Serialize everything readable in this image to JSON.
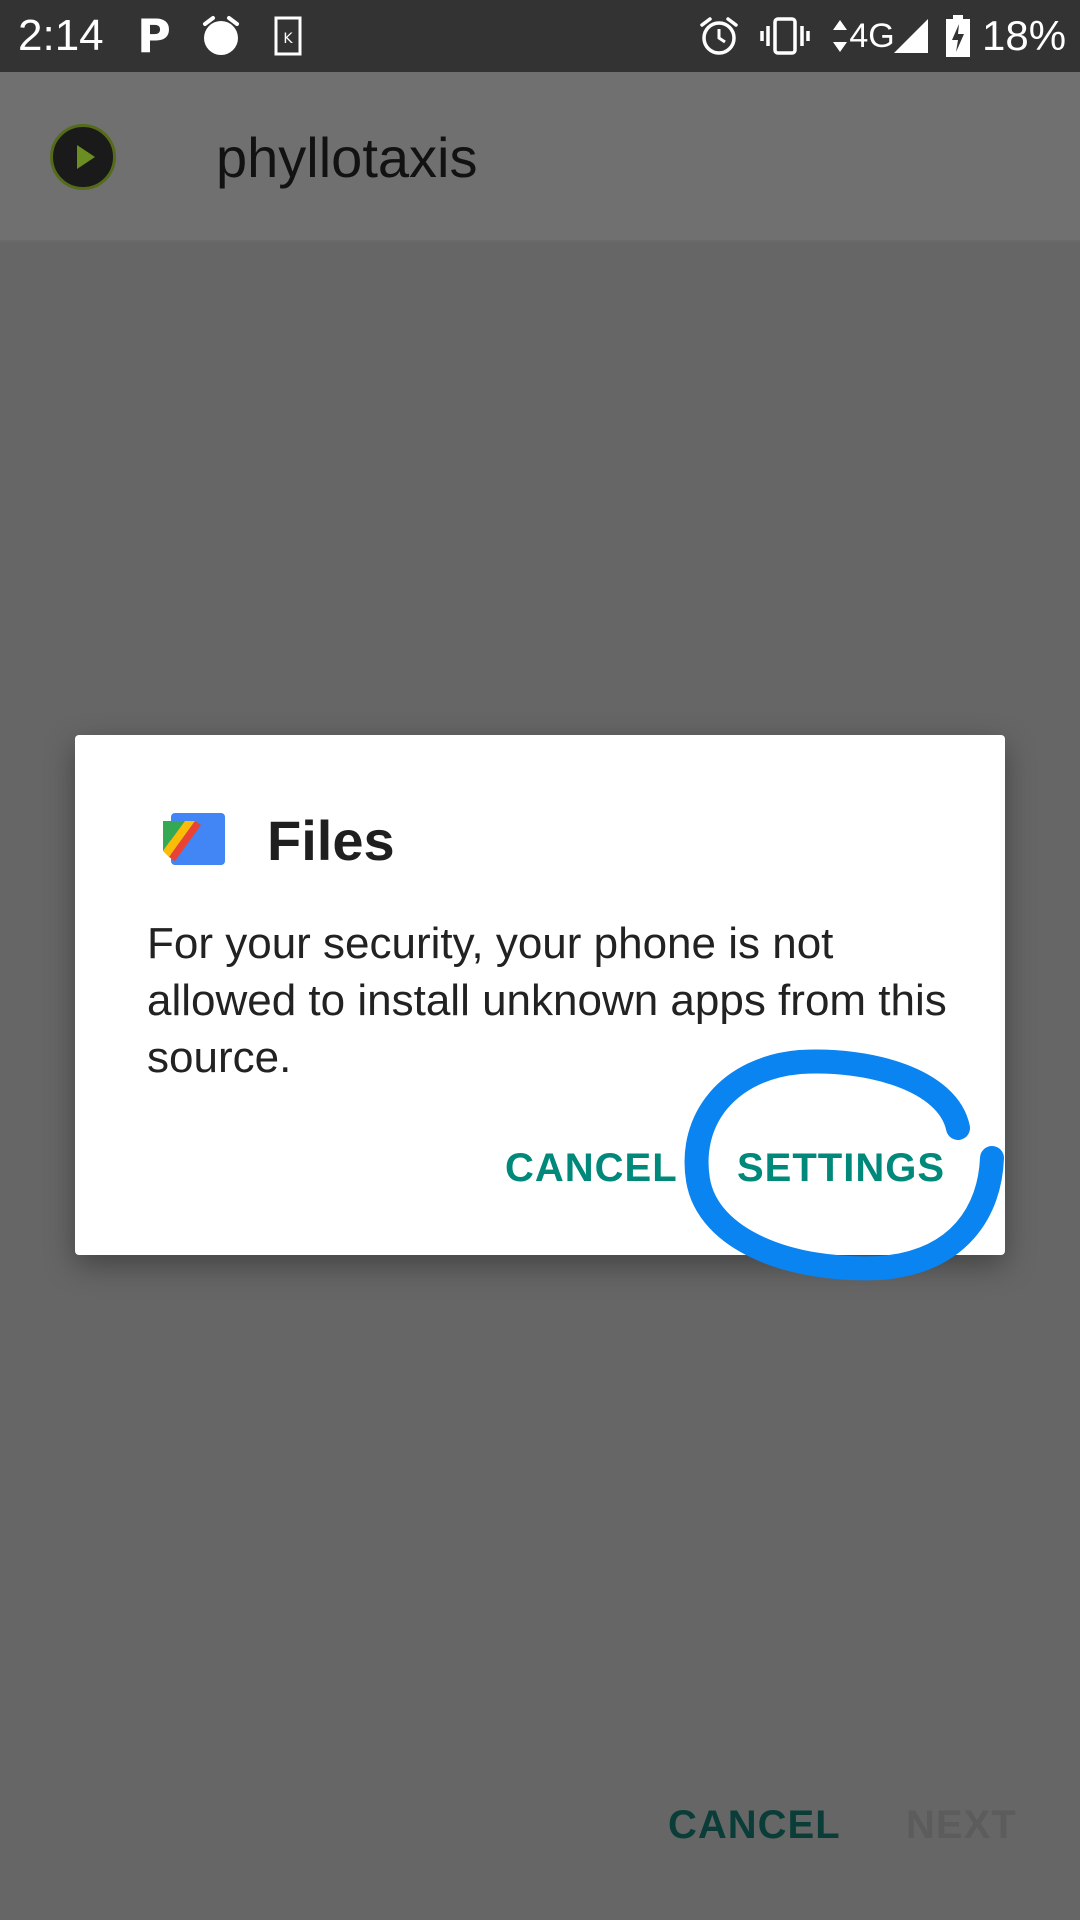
{
  "status_bar": {
    "time": "2:14",
    "network": "4G",
    "battery": "18%",
    "icons": [
      "pandora-icon",
      "alarm-dot-icon",
      "kindle-icon",
      "alarm-icon",
      "vibrate-icon",
      "mobile-data-icon",
      "signal-icon",
      "battery-charging-icon"
    ]
  },
  "app_bar": {
    "title": "phyllotaxis",
    "logo_icon": "app-logo-icon"
  },
  "dialog": {
    "icon": "files-app-icon",
    "title": "Files",
    "message": "For your security, your phone is not allowed to install unknown apps from this source.",
    "cancel_label": "CANCEL",
    "settings_label": "SETTINGS"
  },
  "bottom_buttons": {
    "cancel_label": "CANCEL",
    "next_label": "NEXT"
  },
  "annotation": {
    "shape": "hand-drawn-circle",
    "target": "SETTINGS",
    "color": "#0a84f0"
  },
  "colors": {
    "accent": "#00897b",
    "scrim_background": "#666666",
    "status_bar": "#333333"
  }
}
